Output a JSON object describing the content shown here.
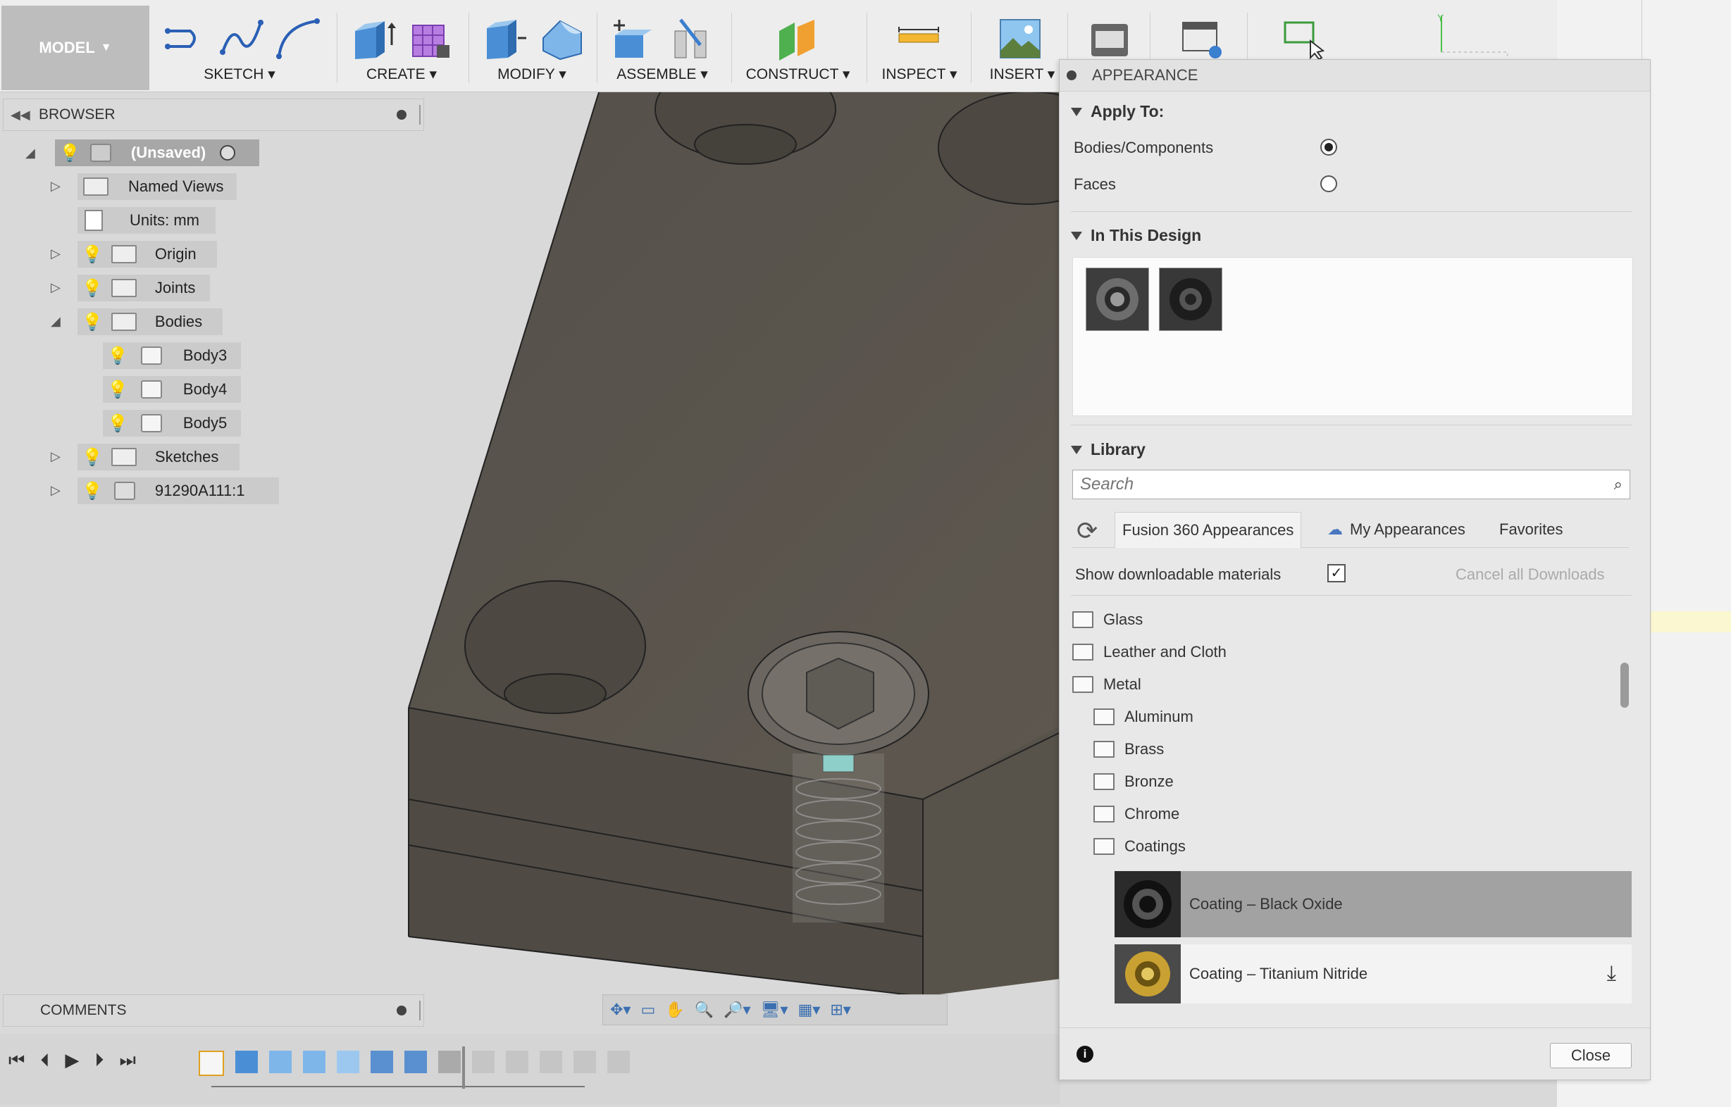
{
  "toolbar": {
    "workspace": "MODEL",
    "groups": [
      "SKETCH",
      "CREATE",
      "MODIFY",
      "ASSEMBLE",
      "CONSTRUCT",
      "INSPECT",
      "INSERT"
    ]
  },
  "browser": {
    "title": "BROWSER",
    "root": "(Unsaved)",
    "items": [
      "Named Views",
      "Units: mm",
      "Origin",
      "Joints",
      "Bodies",
      "Body3",
      "Body4",
      "Body5",
      "Sketches",
      "91290A111:1"
    ]
  },
  "comments": {
    "title": "COMMENTS"
  },
  "appearance": {
    "title": "APPEARANCE",
    "apply_to": {
      "title": "Apply To:",
      "options": [
        "Bodies/Components",
        "Faces"
      ],
      "selected": "Bodies/Components"
    },
    "in_design": {
      "title": "In This Design"
    },
    "library": {
      "title": "Library",
      "search_placeholder": "Search",
      "tabs": [
        "Fusion 360 Appearances",
        "My Appearances",
        "Favorites"
      ],
      "show_downloadable": "Show downloadable materials",
      "show_downloadable_checked": true,
      "cancel_downloads": "Cancel all Downloads",
      "folders": [
        "Glass",
        "Leather and Cloth",
        "Metal"
      ],
      "subfolders": [
        "Aluminum",
        "Brass",
        "Bronze",
        "Chrome",
        "Coatings"
      ],
      "materials": [
        "Coating – Black Oxide",
        "Coating – Titanium Nitride"
      ]
    },
    "close": "Close"
  },
  "colors": {
    "body_face": "#57524a",
    "body_side": "#4e4a43",
    "selected_row": "#9f9f9f"
  }
}
